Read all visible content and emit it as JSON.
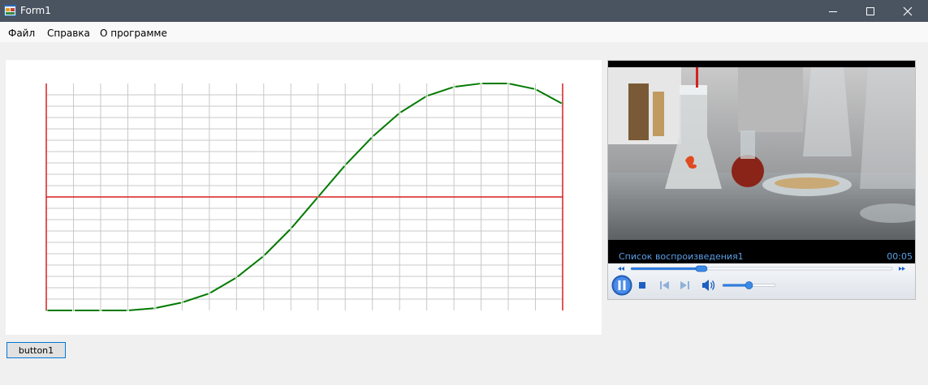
{
  "window": {
    "title": "Form1",
    "controls": {
      "minimize": "minimize-icon",
      "maximize": "maximize-icon",
      "close": "close-icon"
    }
  },
  "menu": {
    "items": [
      "Файл",
      "Справка",
      "О программе"
    ]
  },
  "player": {
    "playlist": "Список воспроизведения1",
    "time": "00:05",
    "progress": 0.27,
    "volume": 0.5,
    "icons": [
      "rewind-icon",
      "fast-forward-icon",
      "pause-icon",
      "stop-icon",
      "previous-icon",
      "next-icon",
      "volume-icon"
    ]
  },
  "button1": {
    "label": "button1"
  },
  "colors": {
    "titlebar": "#4a5461",
    "grid": "#c8c8c8",
    "axis": "#d62020",
    "curve": "#007a00",
    "player_text": "#5aa0e6"
  },
  "chart_data": {
    "type": "line",
    "title": "",
    "xlabel": "",
    "ylabel": "",
    "grid": true,
    "xlim": [
      0,
      19
    ],
    "ylim": [
      -1,
      1
    ],
    "grid_columns": 19,
    "grid_rows": 20,
    "series": [
      {
        "x": [
          0,
          1,
          2,
          3,
          4,
          5,
          6,
          7,
          8,
          9,
          10,
          11,
          12,
          13,
          14,
          15,
          16,
          17,
          18,
          19
        ],
        "y": [
          -1.0,
          -1.0,
          -1.0,
          -1.0,
          -0.98,
          -0.93,
          -0.85,
          -0.71,
          -0.52,
          -0.28,
          0.0,
          0.28,
          0.53,
          0.74,
          0.89,
          0.97,
          1.0,
          1.0,
          0.95,
          0.82
        ]
      }
    ]
  }
}
